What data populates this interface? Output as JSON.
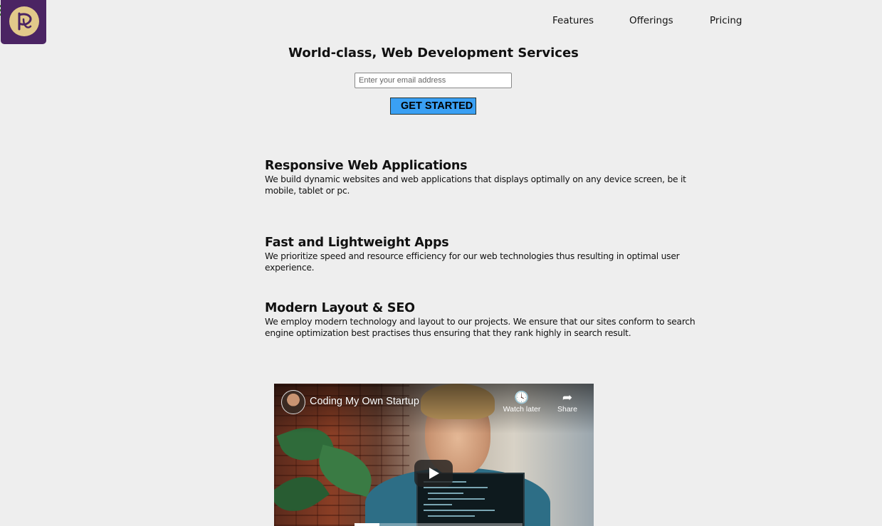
{
  "logo": {
    "alt": "Logo",
    "accent": "#4b2463",
    "emblem": "#e2c98a"
  },
  "nav": {
    "items": [
      {
        "label": "Features"
      },
      {
        "label": "Offerings"
      },
      {
        "label": "Pricing"
      }
    ]
  },
  "hero": {
    "title": "World-class, Web Development Services",
    "email_placeholder": "Enter your email address",
    "email_value": "",
    "cta_label": "GET STARTED",
    "cta_color": "#3aa0f4"
  },
  "features": [
    {
      "title": "Responsive Web Applications",
      "description": "We build dynamic websites and web applications that displays optimally on any device screen, be it mobile, tablet or pc."
    },
    {
      "title": "Fast and Lightweight Apps",
      "description": "We prioritize speed and resource efficiency for our web technologies thus resulting in optimal user experience."
    },
    {
      "title": "Modern Layout & SEO",
      "description": "We employ modern technology and layout to our projects. We ensure that our sites conform to search engine optimization best practises thus ensuring that they rank highly in search result."
    }
  ],
  "video": {
    "title": "Coding My Own Startup",
    "watch_later_label": "Watch later",
    "share_label": "Share",
    "watch_later_icon": "clock-icon",
    "share_icon": "share-arrow-icon",
    "play_icon": "play-icon",
    "progress": 0.15
  }
}
